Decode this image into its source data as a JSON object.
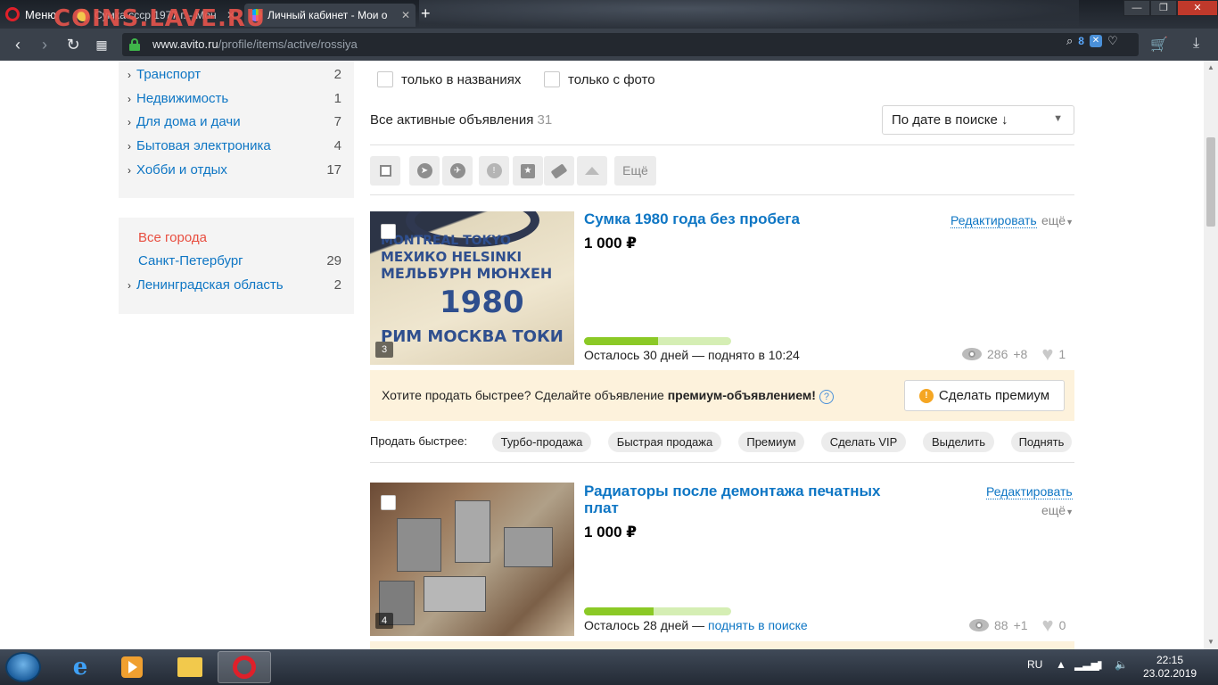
{
  "browser": {
    "menu_label": "Меню",
    "watermark": "COINS.LAVE.RU",
    "tabs": [
      {
        "label": "Сумка ссср 1977 г. - Мон",
        "active": false
      },
      {
        "label": "Личный кабинет - Мои о",
        "active": true
      }
    ],
    "new_tab": "+",
    "url_host": "www.avito.ru",
    "url_path": "/profile/items/active/rossiya",
    "ext_count": "8",
    "ext_badge": "✕",
    "window_controls": {
      "minimize": "—",
      "maximize": "❐",
      "close": "✕"
    }
  },
  "sidebar": {
    "categories": [
      {
        "label": "Транспорт",
        "count": "2"
      },
      {
        "label": "Недвижимость",
        "count": "1"
      },
      {
        "label": "Для дома и дачи",
        "count": "7"
      },
      {
        "label": "Бытовая электроника",
        "count": "4"
      },
      {
        "label": "Хобби и отдых",
        "count": "17"
      }
    ],
    "cities": {
      "all": "Все города",
      "items": [
        {
          "label": "Санкт-Петербург",
          "count": "29"
        },
        {
          "label": "Ленинградская область",
          "count": "2"
        }
      ]
    }
  },
  "filters": {
    "names_only": "только в названиях",
    "with_photo": "только с фото"
  },
  "summary": {
    "label": "Все активные объявления",
    "count": "31",
    "sort_value": "По дате в поиске ↓"
  },
  "toolbar": {
    "more_label": "Ещё"
  },
  "items": [
    {
      "title": "Сумка 1980 года без пробега",
      "price": "1 000 ₽",
      "edit": "Редактировать",
      "more": "ещё",
      "photo_count": "3",
      "remaining": "Осталось 30 дней — поднято в 10:24",
      "progress": 0.5,
      "views": "286",
      "views_new": "+8",
      "favorites": "1",
      "photo_text": [
        "MONTREAL TOKYO",
        "МЕХИКО HELSINKI",
        "МЕЛЬБУРН МЮНХЕН",
        "1980",
        "РИМ МОСКВА ТОКИО"
      ]
    },
    {
      "title": "Радиаторы после демонтажа печатных плат",
      "price": "1 000 ₽",
      "edit": "Редактировать",
      "more": "ещё",
      "photo_count": "4",
      "remaining_prefix": "Осталось 28 дней — ",
      "remaining_link": "поднять в поиске",
      "progress": 0.47,
      "views": "88",
      "views_new": "+1",
      "favorites": "0"
    }
  ],
  "promo": {
    "text": "Хотите продать быстрее? Сделайте объявление ",
    "bold": "премиум-объявлением!",
    "help": "?",
    "button": "Сделать премиум",
    "coin": "!"
  },
  "sell_faster": {
    "label": "Продать быстрее:",
    "options": [
      "Турбо-продажа",
      "Быстрая продажа",
      "Премиум",
      "Сделать VIP",
      "Выделить",
      "Поднять"
    ]
  },
  "taskbar": {
    "lang": "RU",
    "time": "22:15",
    "date": "23.02.2019"
  }
}
